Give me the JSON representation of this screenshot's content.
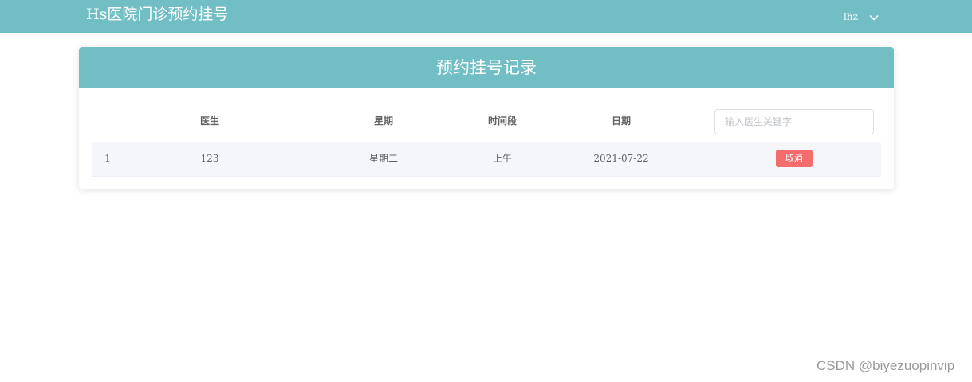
{
  "header": {
    "app_title": "Hs医院门诊预约挂号",
    "user_name": "lhz",
    "user_menu_icon": "chevron-down-icon"
  },
  "card": {
    "title": "预约挂号记录"
  },
  "table": {
    "columns": [
      "",
      "医生",
      "星期",
      "时间段",
      "日期",
      ""
    ],
    "search_placeholder": "输入医生关键字",
    "search_value": "",
    "rows": [
      {
        "index": "1",
        "doctor": "123",
        "weekday": "星期二",
        "period": "上午",
        "date": "2021-07-22",
        "action_label": "取消"
      }
    ]
  },
  "watermark": "CSDN @biyezuopinvip",
  "colors": {
    "primary": "#71bfc4",
    "danger": "#f56c6c",
    "row_bg": "#f4f6f9",
    "text": "#606266"
  }
}
